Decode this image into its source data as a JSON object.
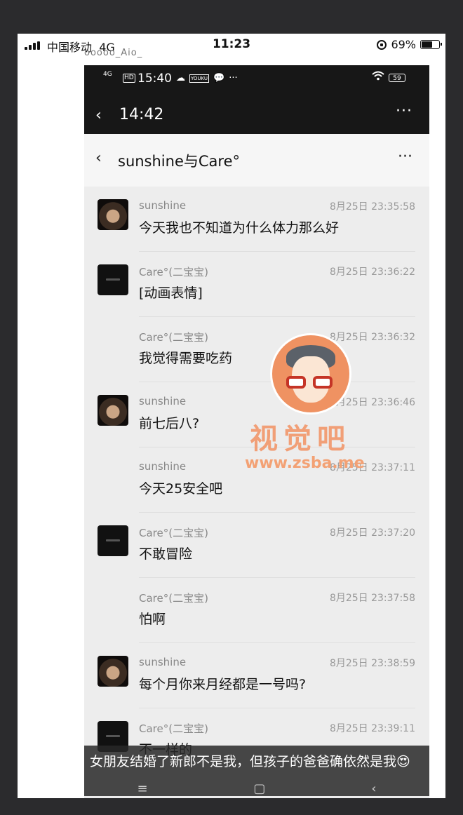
{
  "outer_status": {
    "carrier": "中国移动",
    "network": "4G",
    "time": "11:23",
    "battery": "69%",
    "battery_level": 0.69
  },
  "cutoff_text": "ooooo_Aio_",
  "inner_status": {
    "network": "4G",
    "hd": "HD",
    "time": "15:40",
    "icons": [
      "☁",
      "YOUKU",
      "💬",
      "···"
    ],
    "battery": "59",
    "wifi": "wifi-icon"
  },
  "inner_nav": {
    "back": "‹",
    "title": "14:42",
    "more": "···"
  },
  "chat": {
    "title": "sunshine与Care°",
    "back": "‹",
    "more": "···"
  },
  "messages": [
    {
      "sender": "sunshine",
      "time": "8月25日 23:35:58",
      "text": "今天我也不知道为什么体力那么好",
      "avatar": "sunshine"
    },
    {
      "sender": "Care°(二宝宝)",
      "time": "8月25日 23:36:22",
      "text": "[动画表情]",
      "avatar": "care"
    },
    {
      "sender": "Care°(二宝宝)",
      "time": "8月25日 23:36:32",
      "text": "我觉得需要吃药",
      "avatar": ""
    },
    {
      "sender": "sunshine",
      "time": "8月25日 23:36:46",
      "text": "前七后八?",
      "avatar": "sunshine"
    },
    {
      "sender": "sunshine",
      "time": "8月25日 23:37:11",
      "text": "今天25安全吧",
      "avatar": ""
    },
    {
      "sender": "Care°(二宝宝)",
      "time": "8月25日 23:37:20",
      "text": "不敢冒险",
      "avatar": "care"
    },
    {
      "sender": "Care°(二宝宝)",
      "time": "8月25日 23:37:58",
      "text": "怕啊",
      "avatar": ""
    },
    {
      "sender": "sunshine",
      "time": "8月25日 23:38:59",
      "text": "每个月你来月经都是一号吗?",
      "avatar": "sunshine"
    },
    {
      "sender": "Care°(二宝宝)",
      "time": "8月25日 23:39:11",
      "text": "不一样的",
      "avatar": "care"
    }
  ],
  "subtitle": "女朋友结婚了新郎不是我，但孩子的爸爸确依然是我😍",
  "bottom_nav": [
    "≡",
    "▢",
    "‹"
  ],
  "watermark": {
    "text": "视觉吧",
    "url": "www.zsba.me"
  }
}
